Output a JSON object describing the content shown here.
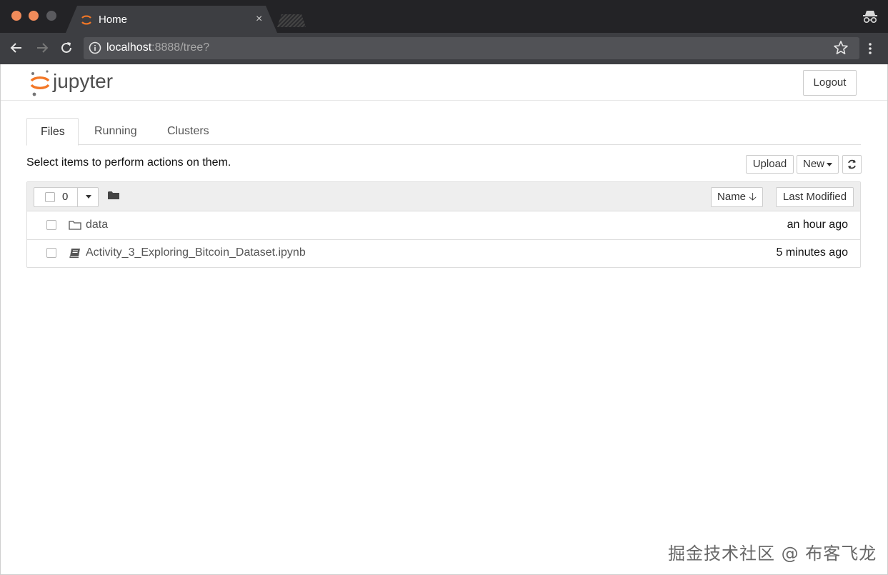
{
  "browser": {
    "tab_title": "Home",
    "tab_close": "×",
    "url_host": "localhost",
    "url_rest": ":8888/tree?"
  },
  "header": {
    "logo_text": "jupyter",
    "logout_label": "Logout"
  },
  "tabs": [
    {
      "label": "Files",
      "active": true
    },
    {
      "label": "Running",
      "active": false
    },
    {
      "label": "Clusters",
      "active": false
    }
  ],
  "hint_text": "Select items to perform actions on them.",
  "actions": {
    "upload_label": "Upload",
    "new_label": "New"
  },
  "list_header": {
    "selected_count": "0",
    "sort_name_label": "Name",
    "sort_name_arrow": "🡣",
    "sort_modified_label": "Last Modified"
  },
  "files": [
    {
      "name": "data",
      "type": "folder",
      "modified": "an hour ago"
    },
    {
      "name": "Activity_3_Exploring_Bitcoin_Dataset.ipynb",
      "type": "notebook",
      "modified": "5 minutes ago"
    }
  ],
  "watermark": "掘金技术社区 @ 布客飞龙",
  "colors": {
    "jupyter_orange": "#f37726",
    "chrome_dark": "#232326",
    "chrome_toolbar": "#3d3e42"
  }
}
